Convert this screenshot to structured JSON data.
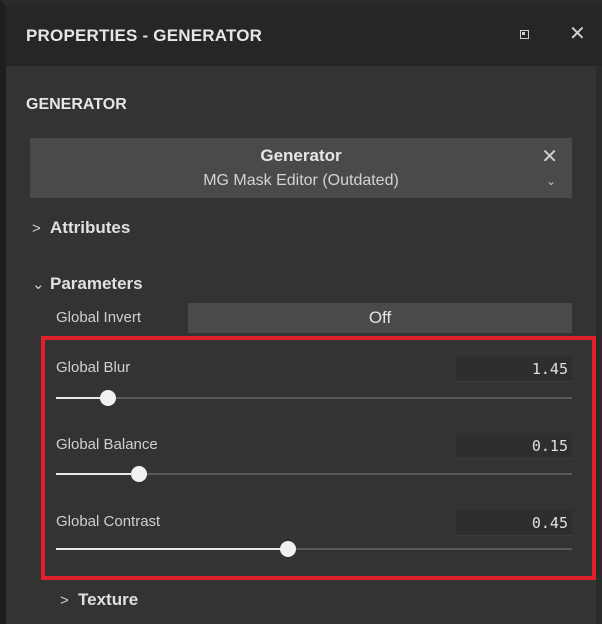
{
  "window": {
    "title": "PROPERTIES - GENERATOR",
    "float_icon": "float-window-icon",
    "close_glyph": "✕"
  },
  "section_heading": "GENERATOR",
  "generator": {
    "title": "Generator",
    "value": "MG Mask Editor (Outdated)",
    "close_glyph": "✕",
    "dropdown_glyph": "⌄"
  },
  "groups": {
    "attributes": {
      "label": "Attributes",
      "chevron": ">",
      "expanded": false
    },
    "parameters": {
      "label": "Parameters",
      "chevron": "⌄",
      "expanded": true
    },
    "texture": {
      "label": "Texture",
      "chevron": ">",
      "expanded": false
    }
  },
  "global_invert": {
    "label": "Global Invert",
    "value": "Off"
  },
  "sliders": [
    {
      "label": "Global Blur",
      "value": "1.45",
      "fraction": 0.1
    },
    {
      "label": "Global Balance",
      "value": "0.15",
      "fraction": 0.16
    },
    {
      "label": "Global Contrast",
      "value": "0.45",
      "fraction": 0.45
    }
  ],
  "colors": {
    "panel_bg": "#333333",
    "title_bg": "#262626",
    "highlight_border": "#e0202a"
  }
}
